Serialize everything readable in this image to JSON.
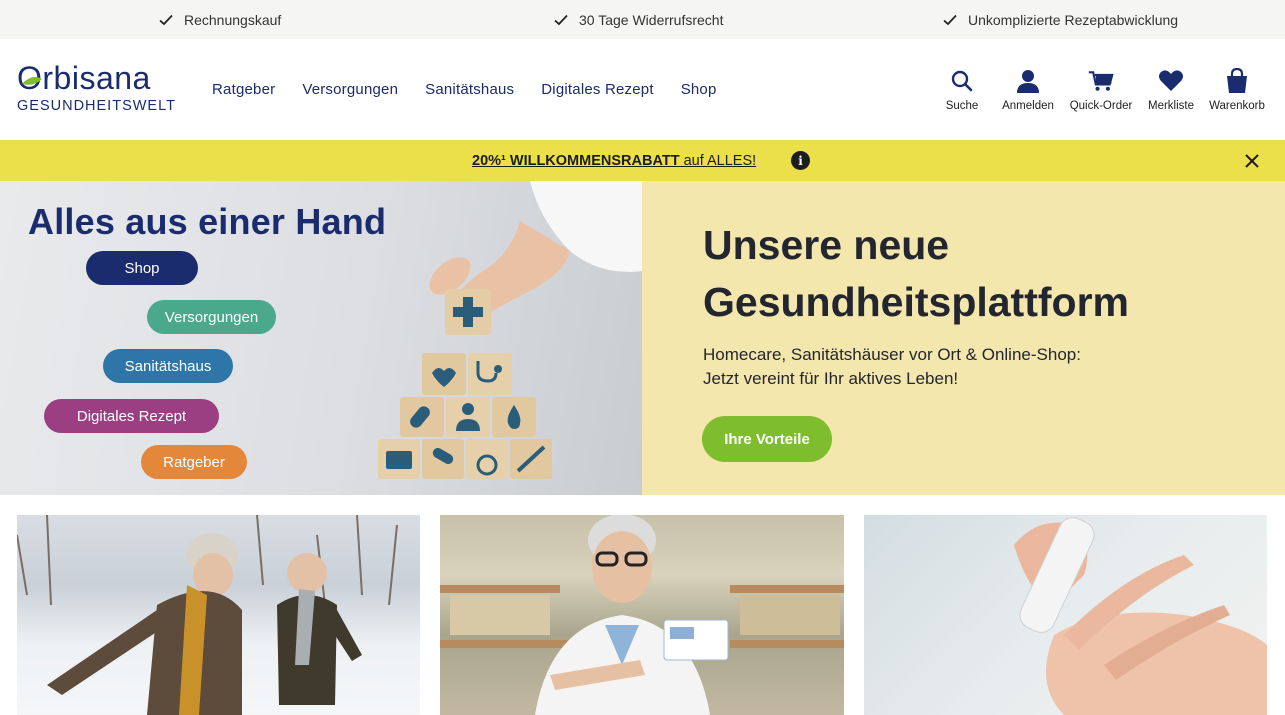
{
  "usp": [
    {
      "icon": "check-icon",
      "text": "Rechnungskauf"
    },
    {
      "icon": "check-icon",
      "text": "30 Tage Widerrufsrecht"
    },
    {
      "icon": "check-icon",
      "text": "Unkomplizierte Rezeptabwicklung"
    }
  ],
  "logo": {
    "name": "Orbisana",
    "tagline": "GESUNDHEITSWELT"
  },
  "nav": [
    "Ratgeber",
    "Versorgungen",
    "Sanitätshaus",
    "Digitales Rezept",
    "Shop"
  ],
  "header_icons": [
    {
      "icon": "search-icon",
      "label": "Suche"
    },
    {
      "icon": "user-icon",
      "label": "Anmelden"
    },
    {
      "icon": "cart-icon",
      "label": "Quick-Order"
    },
    {
      "icon": "heart-icon",
      "label": "Merkliste"
    },
    {
      "icon": "bag-icon",
      "label": "Warenkorb"
    }
  ],
  "promo": {
    "bold": "20%¹ WILLKOMMENSRABATT",
    "rest": " auf ALLES!",
    "info_icon": "info-icon",
    "close_icon": "close-icon",
    "background": "#ece04a"
  },
  "hero": {
    "title": "Alles aus einer Hand",
    "pills": [
      {
        "label": "Shop",
        "color": "#1a2b6e"
      },
      {
        "label": "Versorgungen",
        "color": "#4aa98a"
      },
      {
        "label": "Sanitätshaus",
        "color": "#2e75a8"
      },
      {
        "label": "Digitales Rezept",
        "color": "#9b3f82"
      },
      {
        "label": "Ratgeber",
        "color": "#e3873b"
      }
    ],
    "headline": "Unsere neue Gesundheitsplattform",
    "subtext_line1": "Homecare, Sanitätshäuser vor Ort & Online-Shop:",
    "subtext_line2": "Jetzt vereint für Ihr aktives Leben!",
    "cta": "Ihre Vorteile"
  },
  "colors": {
    "brand": "#1a2b6e",
    "accent_green": "#7ebd2e",
    "hero_right_bg": "#f3e7ae"
  }
}
